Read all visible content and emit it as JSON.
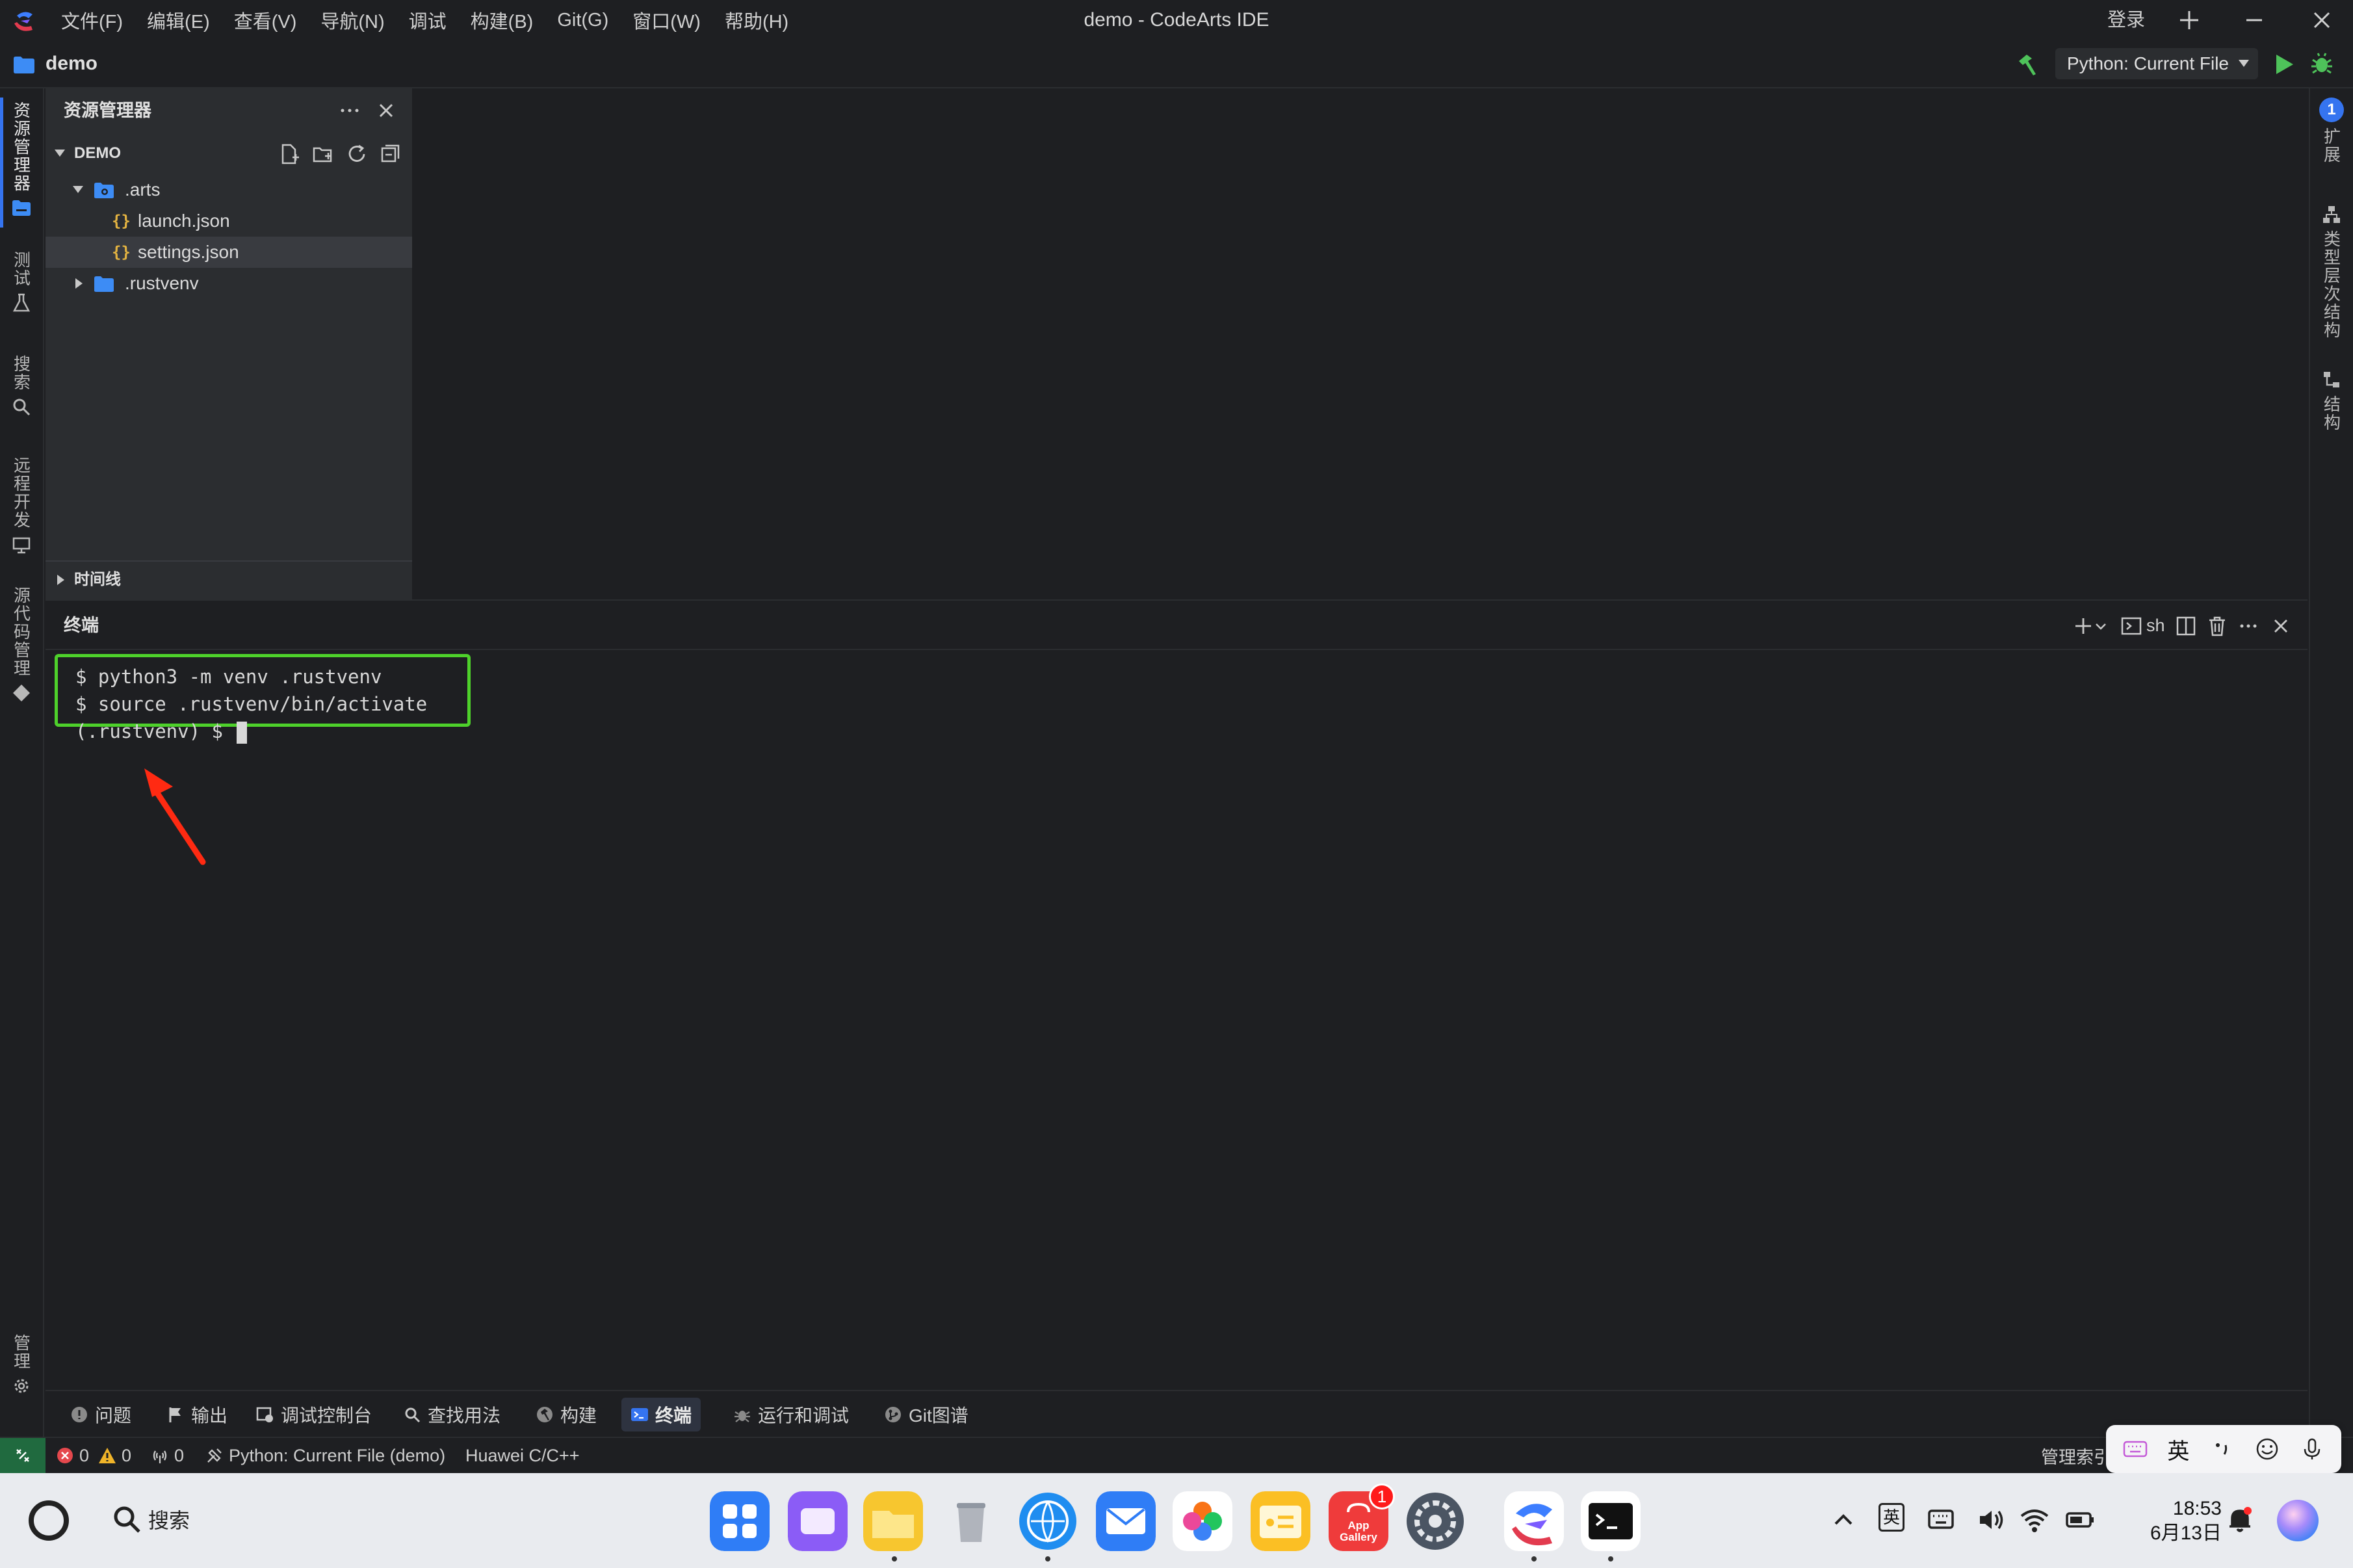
{
  "window": {
    "title": "demo - CodeArts IDE",
    "menu": [
      "文件(F)",
      "编辑(E)",
      "查看(V)",
      "导航(N)",
      "调试",
      "构建(B)",
      "Git(G)",
      "窗口(W)",
      "帮助(H)"
    ],
    "login": "登录"
  },
  "project": {
    "name": "demo",
    "run_config": "Python: Current File"
  },
  "activity_left": {
    "explorer": "资源管理器",
    "test": "测试",
    "search": "搜索",
    "remote": "远程开发",
    "scm": "源代码管理",
    "manage": "管理"
  },
  "activity_right": {
    "extensions": "扩展",
    "extensions_badge": "1",
    "type_hierarchy": "类型层次结构",
    "structure": "结构"
  },
  "explorer": {
    "title": "资源管理器",
    "root": "DEMO",
    "tree": [
      {
        "label": ".arts",
        "type": "folder",
        "expanded": true
      },
      {
        "label": "launch.json",
        "type": "json"
      },
      {
        "label": "settings.json",
        "type": "json",
        "selected": true
      },
      {
        "label": ".rustvenv",
        "type": "folder",
        "expanded": false
      }
    ],
    "json_glyph": "{}",
    "timeline": "时间线"
  },
  "terminal": {
    "title": "终端",
    "shell": "sh",
    "lines": [
      "$ python3 -m venv .rustvenv",
      "$ source .rustvenv/bin/activate",
      "(.rustvenv) $ "
    ]
  },
  "panel_tabs": [
    {
      "label": "问题",
      "icon": "info-icon"
    },
    {
      "label": "输出",
      "icon": "flag-icon"
    },
    {
      "label": "调试控制台",
      "icon": "debug-console-icon"
    },
    {
      "label": "查找用法",
      "icon": "search-icon"
    },
    {
      "label": "构建",
      "icon": "hammer-icon"
    },
    {
      "label": "终端",
      "icon": "terminal-icon",
      "active": true
    },
    {
      "label": "运行和调试",
      "icon": "bug-icon"
    },
    {
      "label": "Git图谱",
      "icon": "git-graph-icon"
    }
  ],
  "statusbar": {
    "errors": "0",
    "warnings": "0",
    "ports": "0",
    "run_config": "Python: Current File (demo)",
    "language": "Huawei C/C++",
    "right_text": "管理索引"
  },
  "ime": {
    "mode": "英"
  },
  "taskbar": {
    "search": "搜索",
    "appgallery_badge": "1",
    "appgallery_label_1": "App",
    "appgallery_label_2": "Gallery",
    "lang": "英",
    "time": "18:53",
    "date": "6月13日"
  },
  "colors": {
    "accent": "#3574f0",
    "highlight_box": "#4ed12b",
    "annotation_arrow": "#ff2a12",
    "remote_button": "#206a3f"
  }
}
